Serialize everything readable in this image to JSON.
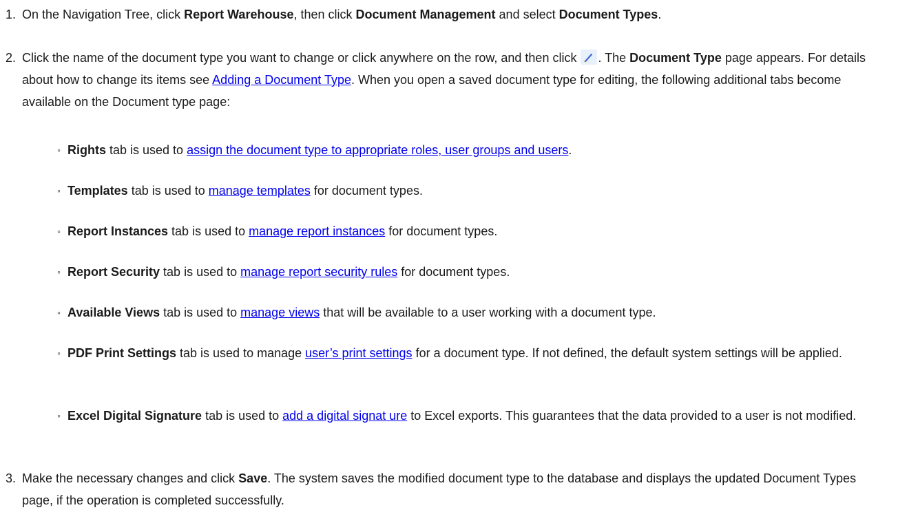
{
  "steps": [
    {
      "number": "1.",
      "parts": [
        {
          "t": "text",
          "v": "On the Navigation Tree, click "
        },
        {
          "t": "bold",
          "v": "Report Warehouse"
        },
        {
          "t": "text",
          "v": ", then click "
        },
        {
          "t": "bold",
          "v": "Document Management"
        },
        {
          "t": "text",
          "v": " and select "
        },
        {
          "t": "bold",
          "v": "Document Types"
        },
        {
          "t": "text",
          "v": "."
        }
      ]
    },
    {
      "number": "2.",
      "parts": [
        {
          "t": "text",
          "v": "Click the name of the document type you want to change or click anywhere on the row, and then click "
        },
        {
          "t": "icon",
          "v": "pencil-edit-icon"
        },
        {
          "t": "text",
          "v": ". The "
        },
        {
          "t": "bold",
          "v": "Document Type"
        },
        {
          "t": "text",
          "v": " page appears. For details about how to change its items see "
        },
        {
          "t": "link",
          "v": "Adding a Document Type"
        },
        {
          "t": "text",
          "v": ". When you open a saved document type for editing, the following additional tabs become available on the Document type page:"
        }
      ]
    },
    {
      "number": "3.",
      "parts": [
        {
          "t": "text",
          "v": "Make the necessary changes and click "
        },
        {
          "t": "bold",
          "v": "Save"
        },
        {
          "t": "text",
          "v": ". The system saves the modified document type to the database and displays the updated Document Types page, if the operation is completed successfully."
        }
      ]
    }
  ],
  "sub_items": [
    {
      "bullet": "◦",
      "parts": [
        {
          "t": "bold",
          "v": "Rights"
        },
        {
          "t": "text",
          "v": " tab is used to "
        },
        {
          "t": "link",
          "v": "assign the document type to appropriate roles, user groups and users"
        },
        {
          "t": "text",
          "v": "."
        }
      ]
    },
    {
      "bullet": "◦",
      "parts": [
        {
          "t": "bold",
          "v": "Templates"
        },
        {
          "t": "text",
          "v": " tab is used to "
        },
        {
          "t": "link",
          "v": "manage templates"
        },
        {
          "t": "text",
          "v": " for document types."
        }
      ]
    },
    {
      "bullet": "◦",
      "parts": [
        {
          "t": "bold",
          "v": "Report Instances"
        },
        {
          "t": "text",
          "v": " tab is used to "
        },
        {
          "t": "link",
          "v": "manage report instances"
        },
        {
          "t": "text",
          "v": " for document types."
        }
      ]
    },
    {
      "bullet": "◦",
      "parts": [
        {
          "t": "bold",
          "v": "Report Security"
        },
        {
          "t": "text",
          "v": " tab is used to "
        },
        {
          "t": "link",
          "v": "manage report security rules"
        },
        {
          "t": "text",
          "v": " for document types."
        }
      ]
    },
    {
      "bullet": "◦",
      "parts": [
        {
          "t": "bold",
          "v": "Available Views"
        },
        {
          "t": "text",
          "v": " tab is used to "
        },
        {
          "t": "link",
          "v": "manage views"
        },
        {
          "t": "text",
          "v": " that will be available to a user working with a document type."
        }
      ]
    },
    {
      "bullet": "◦",
      "parts": [
        {
          "t": "bold",
          "v": "PDF Print Settings"
        },
        {
          "t": "text",
          "v": " tab is used to manage "
        },
        {
          "t": "link",
          "v": "user’s print settings"
        },
        {
          "t": "text",
          "v": " for a document type. If not defined, the default system settings will be applied."
        }
      ]
    },
    {
      "bullet": "◦",
      "parts": [
        {
          "t": "bold",
          "v": "Excel Digital Signature"
        },
        {
          "t": "text",
          "v": " tab is used to "
        },
        {
          "t": "link",
          "v": "add a digital signat ure"
        },
        {
          "t": "text",
          "v": " to Excel exports. This guarantees that the data provided to a user is not modified."
        }
      ]
    }
  ],
  "colors": {
    "text": "#1a1a1a",
    "link": "#0000ee",
    "icon_bg": "#e8f0fb",
    "icon_accent": "#3d6bd6"
  }
}
